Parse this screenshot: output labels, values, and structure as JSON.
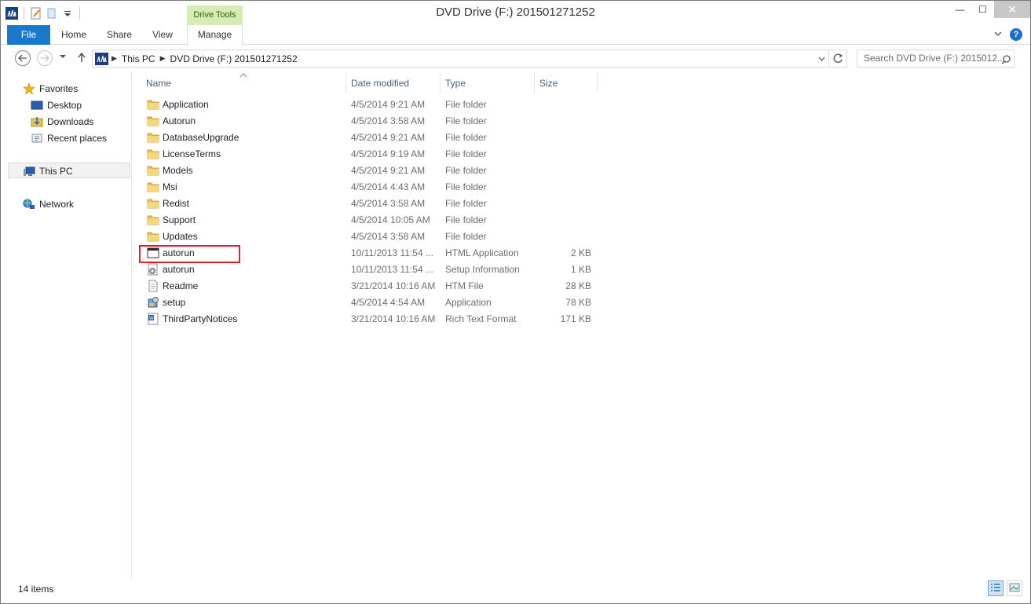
{
  "window": {
    "title": "DVD Drive (F:) 201501271252",
    "controls": {
      "minimize": "—",
      "maximize": "☐",
      "close": "✕"
    }
  },
  "ribbon": {
    "context_header": "Drive Tools",
    "tabs": [
      "File",
      "Home",
      "Share",
      "View",
      "Manage"
    ],
    "help": "?"
  },
  "address": {
    "crumbs": [
      "This PC",
      "DVD Drive (F:) 201501271252"
    ],
    "search_placeholder": "Search DVD Drive (F:) 2015012..."
  },
  "nav_pane": {
    "favorites": "Favorites",
    "favorites_items": [
      "Desktop",
      "Downloads",
      "Recent places"
    ],
    "this_pc": "This PC",
    "network": "Network"
  },
  "columns": {
    "name": "Name",
    "date": "Date modified",
    "type": "Type",
    "size": "Size"
  },
  "files": [
    {
      "name": "Application",
      "date": "4/5/2014 9:21 AM",
      "type": "File folder",
      "size": "",
      "icon": "folder-icon"
    },
    {
      "name": "Autorun",
      "date": "4/5/2014 3:58 AM",
      "type": "File folder",
      "size": "",
      "icon": "folder-icon"
    },
    {
      "name": "DatabaseUpgrade",
      "date": "4/5/2014 9:21 AM",
      "type": "File folder",
      "size": "",
      "icon": "folder-icon"
    },
    {
      "name": "LicenseTerms",
      "date": "4/5/2014 9:19 AM",
      "type": "File folder",
      "size": "",
      "icon": "folder-icon"
    },
    {
      "name": "Models",
      "date": "4/5/2014 9:21 AM",
      "type": "File folder",
      "size": "",
      "icon": "folder-icon"
    },
    {
      "name": "Msi",
      "date": "4/5/2014 4:43 AM",
      "type": "File folder",
      "size": "",
      "icon": "folder-icon"
    },
    {
      "name": "Redist",
      "date": "4/5/2014 3:58 AM",
      "type": "File folder",
      "size": "",
      "icon": "folder-icon"
    },
    {
      "name": "Support",
      "date": "4/5/2014 10:05 AM",
      "type": "File folder",
      "size": "",
      "icon": "folder-icon"
    },
    {
      "name": "Updates",
      "date": "4/5/2014 3:58 AM",
      "type": "File folder",
      "size": "",
      "icon": "folder-icon"
    },
    {
      "name": "autorun",
      "date": "10/11/2013 11:54 ...",
      "type": "HTML Application",
      "size": "2 KB",
      "icon": "hta-icon"
    },
    {
      "name": "autorun",
      "date": "10/11/2013 11:54 ...",
      "type": "Setup Information",
      "size": "1 KB",
      "icon": "setup-info-icon"
    },
    {
      "name": "Readme",
      "date": "3/21/2014 10:16 AM",
      "type": "HTM File",
      "size": "28 KB",
      "icon": "document-icon"
    },
    {
      "name": "setup",
      "date": "4/5/2014 4:54 AM",
      "type": "Application",
      "size": "78 KB",
      "icon": "setup-app-icon"
    },
    {
      "name": "ThirdPartyNotices",
      "date": "3/21/2014 10:16 AM",
      "type": "Rich Text Format",
      "size": "171 KB",
      "icon": "rtf-icon"
    }
  ],
  "status": {
    "item_count": "14 items"
  },
  "colors": {
    "file_tab": "#1979ca",
    "drive_tools": "#d5ecb3",
    "highlight": "#e0202a",
    "folder": "#e8c15a"
  }
}
